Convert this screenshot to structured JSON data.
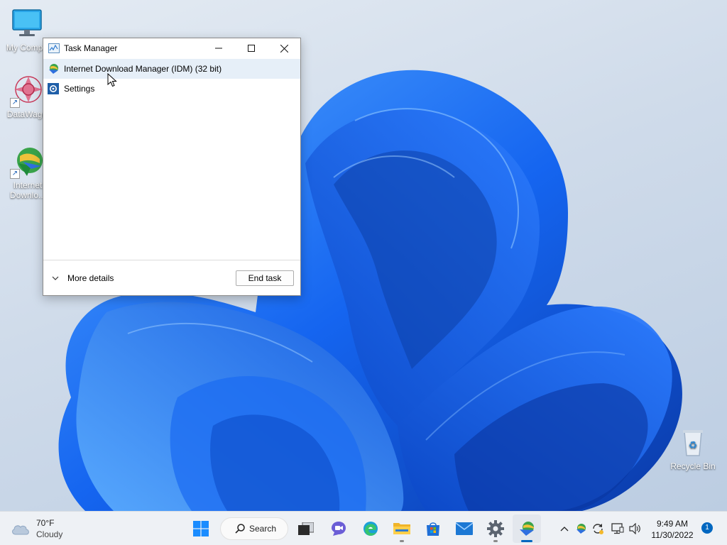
{
  "desktop": {
    "icons": [
      {
        "label": "My Compu"
      },
      {
        "label": "DataWago"
      },
      {
        "label": "Internet Downlo..."
      },
      {
        "label": "Recycle Bin"
      }
    ]
  },
  "task_manager": {
    "title": "Task Manager",
    "processes": [
      {
        "name": "Internet Download Manager (IDM) (32 bit)",
        "selected": true
      },
      {
        "name": "Settings",
        "selected": false
      }
    ],
    "more_details_label": "More details",
    "end_task_label": "End task"
  },
  "taskbar": {
    "weather": {
      "temp": "70°F",
      "condition": "Cloudy"
    },
    "search_label": "Search",
    "apps": [
      "start",
      "search",
      "task-view",
      "chat",
      "edge",
      "file-explorer",
      "store",
      "mail",
      "settings",
      "idm"
    ],
    "clock": {
      "time": "9:49 AM",
      "date": "11/30/2022"
    },
    "notification_count": "1"
  },
  "colors": {
    "accent": "#0067c0",
    "bloom_dark": "#0a3fb8",
    "bloom_light": "#3d8cff"
  }
}
